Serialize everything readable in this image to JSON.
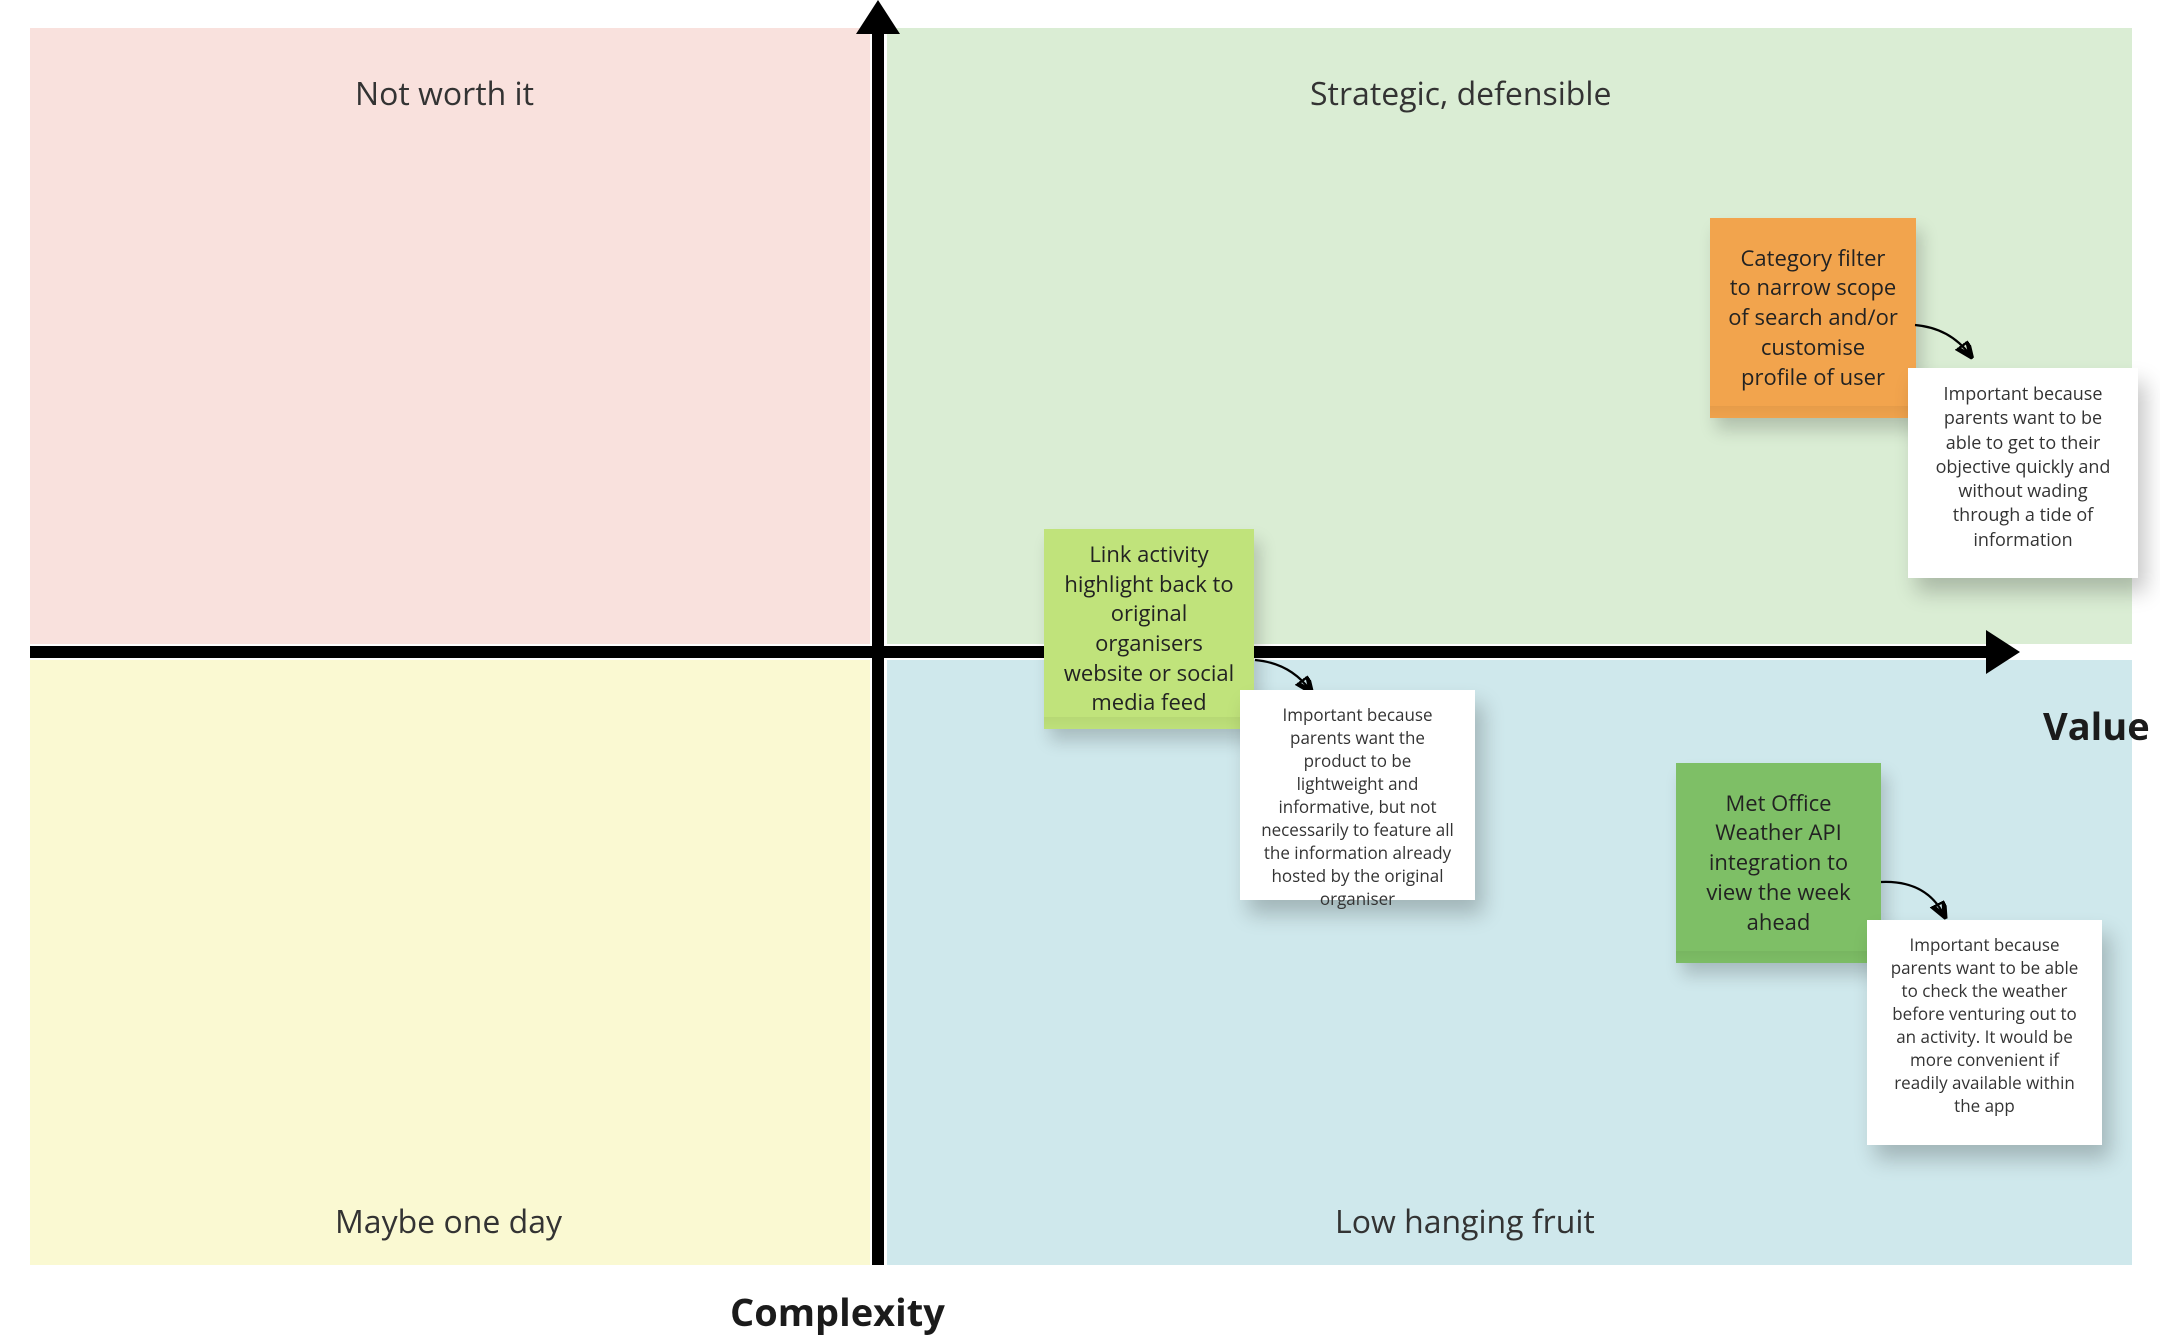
{
  "axes": {
    "x_label": "Value",
    "y_label": "Complexity"
  },
  "quadrants": {
    "top_left": {
      "label": "Not worth it"
    },
    "top_right": {
      "label": "Strategic, defensible"
    },
    "bottom_left": {
      "label": "Maybe one day"
    },
    "bottom_right": {
      "label": "Low hanging fruit"
    }
  },
  "items": {
    "category_filter": {
      "sticky_text": "Category filter to narrow scope of search and/or customise profile of user",
      "note_text": "Important because parents want to be able to get to their objective quickly and without wading through a tide of information"
    },
    "link_activity": {
      "sticky_text": "Link activity highlight back to original organisers website or social media feed",
      "note_text": "Important because parents want the product to be lightweight and informative, but not necessarily to feature all the information already hosted by the original organiser"
    },
    "met_office": {
      "sticky_text": "Met Office Weather API integration to view the week ahead",
      "note_text": "Important because parents want to be able to check the weather before venturing out to an activity. It would be more convenient if readily available within the app"
    }
  }
}
